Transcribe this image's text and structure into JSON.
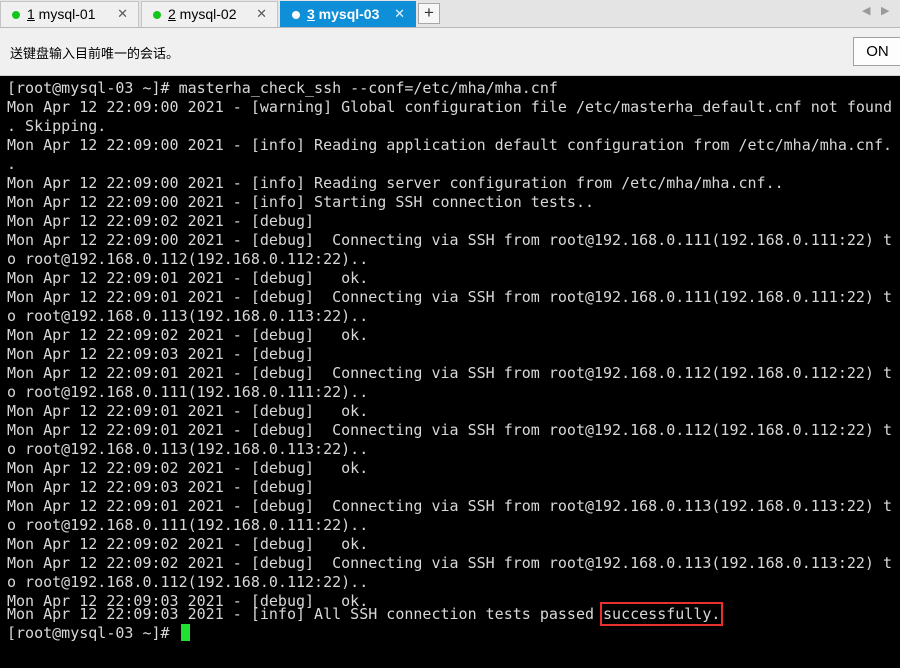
{
  "tabs": [
    {
      "num": "1",
      "label": " mysql-01",
      "close": "✕",
      "active": false
    },
    {
      "num": "2",
      "label": " mysql-02",
      "close": "✕",
      "active": false
    },
    {
      "num": "3",
      "label": " mysql-03",
      "close": "✕",
      "active": true
    }
  ],
  "new_tab_label": "+",
  "broadcast": {
    "message": "送键盘输入目前唯一的会话。",
    "toggle_label": "ON"
  },
  "terminal": {
    "lines": [
      "[root@mysql-03 ~]# masterha_check_ssh --conf=/etc/mha/mha.cnf",
      "Mon Apr 12 22:09:00 2021 - [warning] Global configuration file /etc/masterha_default.cnf not found",
      ". Skipping.",
      "Mon Apr 12 22:09:00 2021 - [info] Reading application default configuration from /etc/mha/mha.cnf.",
      ".",
      "Mon Apr 12 22:09:00 2021 - [info] Reading server configuration from /etc/mha/mha.cnf..",
      "Mon Apr 12 22:09:00 2021 - [info] Starting SSH connection tests..",
      "Mon Apr 12 22:09:02 2021 - [debug]",
      "Mon Apr 12 22:09:00 2021 - [debug]  Connecting via SSH from root@192.168.0.111(192.168.0.111:22) t",
      "o root@192.168.0.112(192.168.0.112:22)..",
      "Mon Apr 12 22:09:01 2021 - [debug]   ok.",
      "Mon Apr 12 22:09:01 2021 - [debug]  Connecting via SSH from root@192.168.0.111(192.168.0.111:22) t",
      "o root@192.168.0.113(192.168.0.113:22)..",
      "Mon Apr 12 22:09:02 2021 - [debug]   ok.",
      "Mon Apr 12 22:09:03 2021 - [debug]",
      "Mon Apr 12 22:09:01 2021 - [debug]  Connecting via SSH from root@192.168.0.112(192.168.0.112:22) t",
      "o root@192.168.0.111(192.168.0.111:22)..",
      "Mon Apr 12 22:09:01 2021 - [debug]   ok.",
      "Mon Apr 12 22:09:01 2021 - [debug]  Connecting via SSH from root@192.168.0.112(192.168.0.112:22) t",
      "o root@192.168.0.113(192.168.0.113:22)..",
      "Mon Apr 12 22:09:02 2021 - [debug]   ok.",
      "Mon Apr 12 22:09:03 2021 - [debug]",
      "Mon Apr 12 22:09:01 2021 - [debug]  Connecting via SSH from root@192.168.0.113(192.168.0.113:22) t",
      "o root@192.168.0.111(192.168.0.111:22)..",
      "Mon Apr 12 22:09:02 2021 - [debug]   ok.",
      "Mon Apr 12 22:09:02 2021 - [debug]  Connecting via SSH from root@192.168.0.113(192.168.0.113:22) t",
      "o root@192.168.0.112(192.168.0.112:22)..",
      "Mon Apr 12 22:09:03 2021 - [debug]   ok."
    ],
    "final_line_prefix": "Mon Apr 12 22:09:03 2021 - [info] All SSH connection tests passed ",
    "final_line_highlight": "successfully.",
    "prompt": "[root@mysql-03 ~]# "
  },
  "colors": {
    "active_tab": "#0f8fd8",
    "session_dot": "#14c51e",
    "terminal_bg": "#000000",
    "terminal_text": "#d8d8d8",
    "highlight_box": "#e8312f",
    "cursor": "#20e030"
  }
}
